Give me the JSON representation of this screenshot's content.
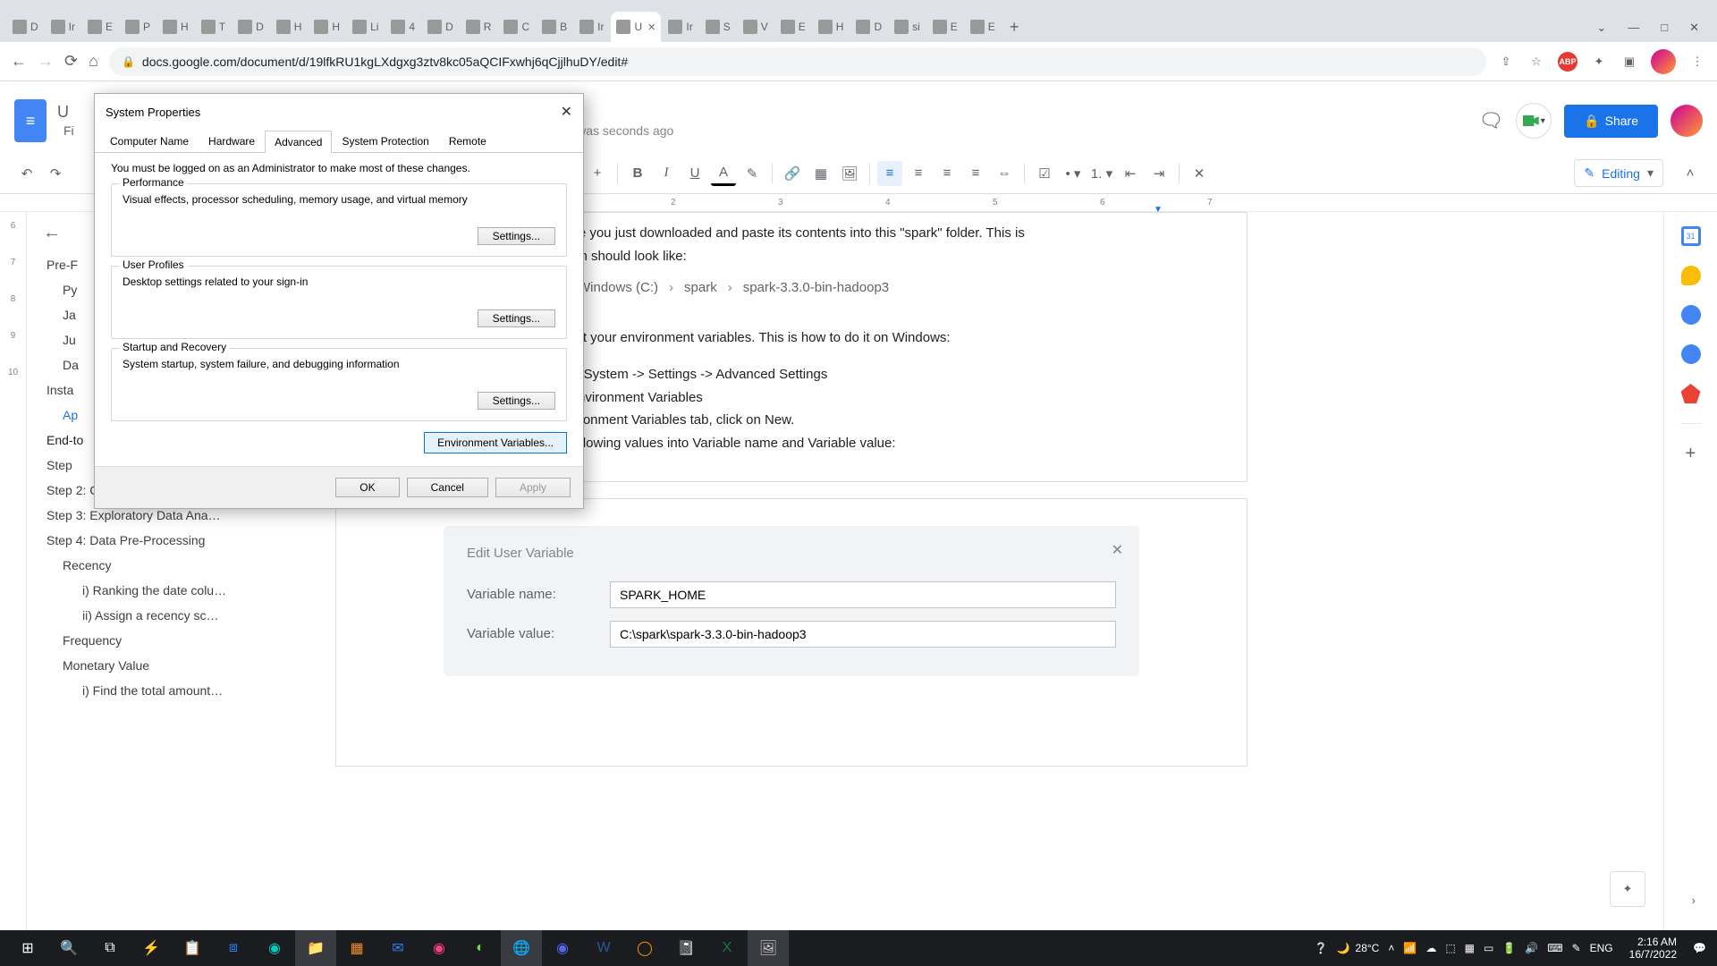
{
  "browser": {
    "tabs": [
      "D",
      "Ir",
      "E",
      "P",
      "H",
      "T",
      "D",
      "H",
      "H",
      "Li",
      "4",
      "D",
      "R",
      "C",
      "B",
      "Ir",
      "U",
      "Ir",
      "S",
      "V",
      "E",
      "H",
      "D",
      "si",
      "E",
      "E"
    ],
    "active_tab_index": 16,
    "win_icons": [
      "⌄",
      "—",
      "□",
      "✕"
    ],
    "nav": {
      "back": "←",
      "forward": "→",
      "reload": "⟳",
      "home": "⌂"
    },
    "url": "docs.google.com/document/d/19lfkRU1kgLXdgxg3ztv8kc05aQCIFxwhj6qCjjlhuDY/edit#",
    "ext": {
      "share": "⇪",
      "star": "☆",
      "abp": "ABP",
      "puzzle": "✦",
      "panel": "▣",
      "menu": "⋮"
    }
  },
  "docs": {
    "title_visible": "U",
    "menus_visible": [
      "Fi"
    ],
    "last_edit": "edit was seconds ago",
    "comment_icon": "🗨",
    "share": "Share",
    "editing": "Editing",
    "toolbar_icons": [
      "↶",
      "↷",
      "+",
      "B",
      "I",
      "U",
      "A",
      "✎",
      "🔗",
      "▦",
      "🖼",
      "≡",
      "≡",
      "≡",
      "≡",
      "⇔",
      "☑",
      "•",
      "1.",
      "⇤",
      "⇥",
      "✕"
    ],
    "ruler_ticks": [
      "2",
      "3",
      "4",
      "5",
      "6",
      "7"
    ]
  },
  "outline": {
    "items": [
      {
        "label": "Pre-F",
        "cls": ""
      },
      {
        "label": "Py",
        "cls": "lvl2"
      },
      {
        "label": "Ja",
        "cls": "lvl2"
      },
      {
        "label": "Ju",
        "cls": "lvl2"
      },
      {
        "label": "Da",
        "cls": "lvl2"
      },
      {
        "label": "Insta",
        "cls": ""
      },
      {
        "label": "Ap",
        "cls": "lvl2 active"
      },
      {
        "label": "End-to",
        "cls": "bold"
      },
      {
        "label": "Step",
        "cls": ""
      },
      {
        "label": "Step 2: Creating the DataFra…",
        "cls": ""
      },
      {
        "label": "Step 3: Exploratory Data Ana…",
        "cls": ""
      },
      {
        "label": "Step 4: Data Pre-Processing",
        "cls": ""
      },
      {
        "label": "Recency",
        "cls": "lvl2"
      },
      {
        "label": "i) Ranking the date colu…",
        "cls": "lvl3"
      },
      {
        "label": "ii) Assign a recency sc…",
        "cls": "lvl3"
      },
      {
        "label": "Frequency",
        "cls": "lvl2"
      },
      {
        "label": "Monetary Value",
        "cls": "lvl2"
      },
      {
        "label": "i) Find the total amount…",
        "cls": "lvl3"
      }
    ]
  },
  "page1": {
    "line1": "file you just downloaded and paste its contents into this \"spark\" folder. This is",
    "line2": "ath should look like:",
    "breadcrumb": [
      "Windows (C:)",
      "spark",
      "spark-3.3.0-bin-hadoop3"
    ],
    "line3": "set your environment variables. This is how to do it on Windows:",
    "li1": "to System -> Settings -> Advanced Settings",
    "li2": "Environment Variables",
    "li3": "vironment Variables tab, click on New.",
    "li4": "following values into Variable name and Variable value:"
  },
  "env_dialog": {
    "title": "Edit User Variable",
    "var_name_label": "Variable name:",
    "var_name_value": "SPARK_HOME",
    "var_value_label": "Variable value:",
    "var_value_value": "C:\\spark\\spark-3.3.0-bin-hadoop3"
  },
  "sysprops": {
    "title": "System Properties",
    "tabs": [
      "Computer Name",
      "Hardware",
      "Advanced",
      "System Protection",
      "Remote"
    ],
    "active_tab": 2,
    "note": "You must be logged on as an Administrator to make most of these changes.",
    "groups": [
      {
        "legend": "Performance",
        "desc": "Visual effects, processor scheduling, memory usage, and virtual memory",
        "btn": "Settings..."
      },
      {
        "legend": "User Profiles",
        "desc": "Desktop settings related to your sign-in",
        "btn": "Settings..."
      },
      {
        "legend": "Startup and Recovery",
        "desc": "System startup, system failure, and debugging information",
        "btn": "Settings..."
      }
    ],
    "env_btn": "Environment Variables...",
    "ok": "OK",
    "cancel": "Cancel",
    "apply": "Apply"
  },
  "taskbar": {
    "weather_temp": "28°C",
    "lang": "ENG",
    "time": "2:16 AM",
    "date": "16/7/2022"
  },
  "gutter": [
    "6",
    "7",
    "8",
    "9",
    "10"
  ]
}
